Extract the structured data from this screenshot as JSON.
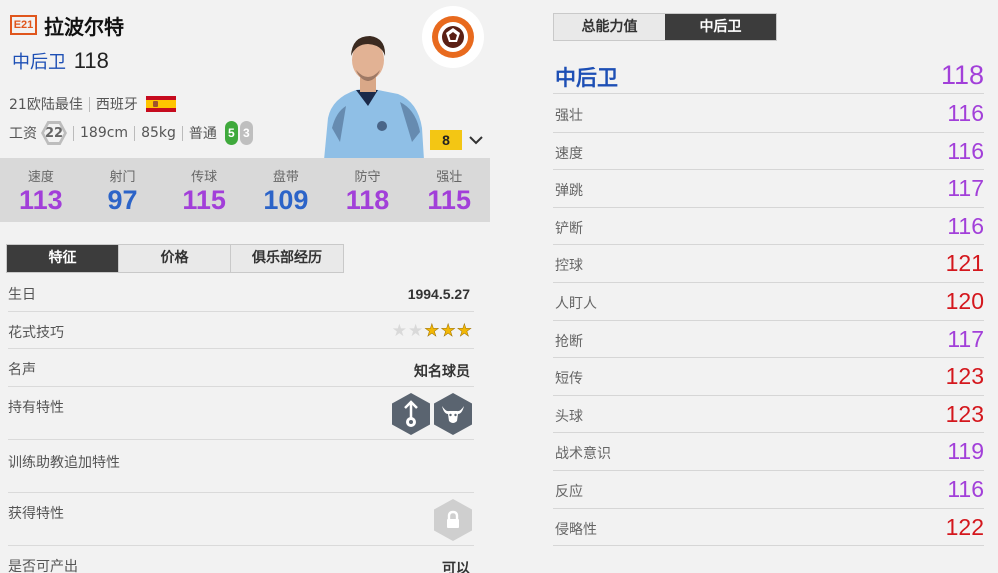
{
  "header": {
    "season_badge": "E21",
    "player_name": "拉波尔特",
    "position": "中后卫",
    "ovr": "118",
    "season": "21欧陆最佳",
    "nation": "西班牙",
    "salary_label": "工资",
    "salary": "22",
    "height": "189cm",
    "weight": "85kg",
    "body_type": "普通",
    "foot_strong": "5",
    "foot_weak": "3",
    "enhance_level": "8"
  },
  "stats": [
    {
      "label": "速度",
      "value": "113",
      "color": "#a23fd9"
    },
    {
      "label": "射门",
      "value": "97",
      "color": "#2c64c8"
    },
    {
      "label": "传球",
      "value": "115",
      "color": "#a23fd9"
    },
    {
      "label": "盘带",
      "value": "109",
      "color": "#2c64c8"
    },
    {
      "label": "防守",
      "value": "118",
      "color": "#a23fd9"
    },
    {
      "label": "强壮",
      "value": "115",
      "color": "#a23fd9"
    }
  ],
  "left_tabs": [
    "特征",
    "价格",
    "俱乐部经历"
  ],
  "info": {
    "birthday_label": "生日",
    "birthday": "1994.5.27",
    "skill_label": "花式技巧",
    "skill_stars": 3,
    "fame_label": "名声",
    "fame": "知名球员",
    "traits_label": "持有特性",
    "coach_traits_label": "训练助教追加特性",
    "earned_traits_label": "获得特性",
    "producible_label": "是否可产出",
    "producible": "可以"
  },
  "right_tabs": [
    "总能力值",
    "中后卫"
  ],
  "position_rating": {
    "name": "中后卫",
    "value": "118"
  },
  "attributes": [
    {
      "label": "强壮",
      "value": "116",
      "color": "#a23fd9"
    },
    {
      "label": "速度",
      "value": "116",
      "color": "#a23fd9"
    },
    {
      "label": "弹跳",
      "value": "117",
      "color": "#a23fd9"
    },
    {
      "label": "铲断",
      "value": "116",
      "color": "#a23fd9"
    },
    {
      "label": "控球",
      "value": "121",
      "color": "#d4171d"
    },
    {
      "label": "人盯人",
      "value": "120",
      "color": "#d4171d"
    },
    {
      "label": "抢断",
      "value": "117",
      "color": "#a23fd9"
    },
    {
      "label": "短传",
      "value": "123",
      "color": "#d4171d"
    },
    {
      "label": "头球",
      "value": "123",
      "color": "#d4171d"
    },
    {
      "label": "战术意识",
      "value": "119",
      "color": "#a23fd9"
    },
    {
      "label": "反应",
      "value": "116",
      "color": "#a23fd9"
    },
    {
      "label": "侵略性",
      "value": "122",
      "color": "#d4171d"
    }
  ]
}
